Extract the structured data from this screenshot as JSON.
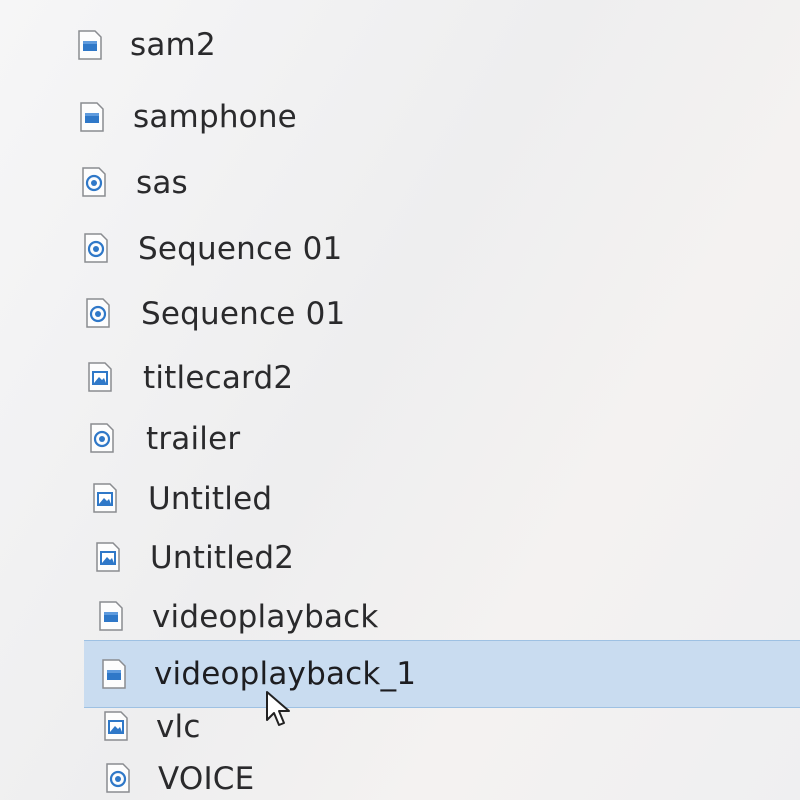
{
  "files": [
    {
      "name": "sam2",
      "icon": "video-file-icon",
      "selected": false
    },
    {
      "name": "samphone",
      "icon": "video-file-icon",
      "selected": false
    },
    {
      "name": "sas",
      "icon": "media-file-icon",
      "selected": false
    },
    {
      "name": "Sequence 01",
      "icon": "media-file-icon",
      "selected": false
    },
    {
      "name": "Sequence 01",
      "icon": "media-file-icon",
      "selected": false
    },
    {
      "name": "titlecard2",
      "icon": "image-file-icon",
      "selected": false
    },
    {
      "name": "trailer",
      "icon": "media-file-icon",
      "selected": false
    },
    {
      "name": "Untitled",
      "icon": "image-file-icon",
      "selected": false
    },
    {
      "name": "Untitled2",
      "icon": "image-file-icon",
      "selected": false
    },
    {
      "name": "videoplayback",
      "icon": "video-file-icon",
      "selected": false
    },
    {
      "name": "videoplayback_1",
      "icon": "video-file-icon",
      "selected": true
    },
    {
      "name": "vlc",
      "icon": "image-file-icon",
      "selected": false
    },
    {
      "name": "VOICE",
      "icon": "media-file-icon",
      "selected": false
    }
  ],
  "colors": {
    "selection_background": "#c9dcf0",
    "selection_border": "#9ec1e3",
    "icon_blue": "#2f78c8",
    "text": "#2a2a2c"
  }
}
